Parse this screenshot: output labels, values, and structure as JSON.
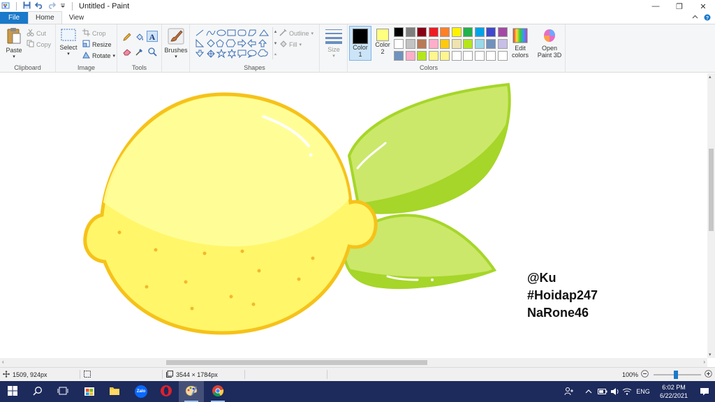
{
  "window": {
    "title": "Untitled - Paint",
    "controls": {
      "minimize": "—",
      "restore": "❐",
      "close": "✕"
    }
  },
  "tabs": [
    {
      "label": "File"
    },
    {
      "label": "Home"
    },
    {
      "label": "View"
    }
  ],
  "ribbon": {
    "clipboard": {
      "paste": "Paste",
      "cut": "Cut",
      "copy": "Copy",
      "group": "Clipboard"
    },
    "image": {
      "select": "Select",
      "crop": "Crop",
      "resize": "Resize",
      "rotate": "Rotate",
      "group": "Image"
    },
    "tools": {
      "group": "Tools"
    },
    "brushes": {
      "label": "Brushes"
    },
    "shapes": {
      "outline": "Outline",
      "fill": "Fill",
      "group": "Shapes"
    },
    "size": {
      "label": "Size"
    },
    "color1": {
      "label": "Color",
      "number": "1",
      "value": "#000000"
    },
    "color2": {
      "label": "Color",
      "number": "2",
      "value": "#ffff80"
    },
    "colors": {
      "group": "Colors",
      "edit_line1": "Edit",
      "edit_line2": "colors"
    },
    "paint3d": {
      "line1": "Open",
      "line2": "Paint 3D"
    },
    "palette": [
      [
        "#000000",
        "#7f7f7f",
        "#880015",
        "#ed1c24",
        "#ff7f27",
        "#fff200",
        "#22b14c",
        "#00a2e8",
        "#3f48cc",
        "#a349a4"
      ],
      [
        "#ffffff",
        "#c3c3c3",
        "#b97a57",
        "#ffaec9",
        "#ffc90e",
        "#efe4b0",
        "#b5e61d",
        "#99d9ea",
        "#7092be",
        "#c8bfe7"
      ],
      [
        "#7092be",
        "#ffaec9",
        "#b5e61d",
        "#fff68f",
        "#fff68f",
        "#ffffff",
        "#ffffff",
        "#ffffff",
        "#ffffff",
        "#ffffff"
      ]
    ]
  },
  "canvas": {
    "text_lines": [
      "@Ku",
      "#Hoidap247",
      "NaRone46"
    ]
  },
  "statusbar": {
    "cursor_pos": "1509, 924px",
    "canvas_size": "3544 × 1784px",
    "zoom": "100%"
  },
  "taskbar": {
    "language": "ENG",
    "time": "6:02 PM",
    "date": "6/22/2021",
    "apps": [
      "start",
      "search",
      "task-view",
      "store",
      "file-explorer",
      "zalo",
      "opera",
      "paint",
      "chrome"
    ],
    "zalo_label": "Zalo"
  }
}
